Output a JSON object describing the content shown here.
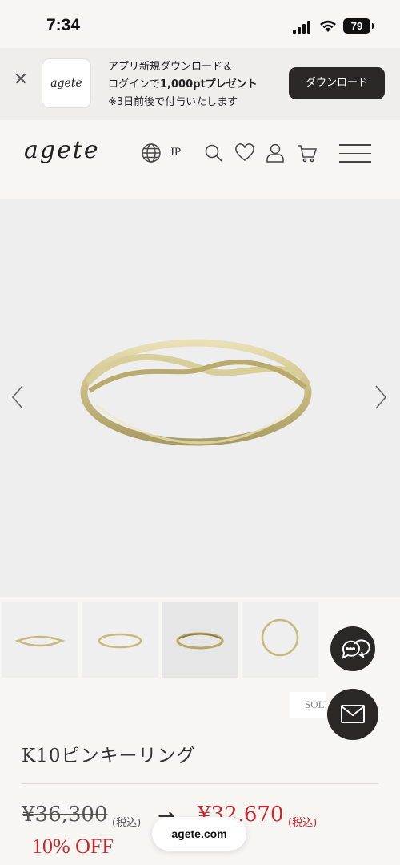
{
  "status_bar": {
    "time": "7:34",
    "battery": "79"
  },
  "app_banner": {
    "logo_text": "agete",
    "line1": "アプリ新規ダウンロード＆",
    "line2_prefix": "ログインで",
    "line2_bold": "1,000ptプレゼント",
    "line3": "※3日前後で付与いたします",
    "download_label": "ダウンロード",
    "close_icon": "close-icon"
  },
  "header": {
    "logo": "agete",
    "lang": "JP",
    "icons": [
      "globe-icon",
      "search-icon",
      "heart-icon",
      "user-icon",
      "cart-icon",
      "menu-icon"
    ]
  },
  "gallery": {
    "thumbnail_count": 4
  },
  "product": {
    "badge": "SOLD",
    "title": "K10ピンキーリング",
    "old_price": "¥36,300",
    "old_tax": "(税込)",
    "arrow": "→",
    "new_price": "¥32,670",
    "new_tax": "(税込)",
    "discount": "10% OFF"
  },
  "browser": {
    "url": "agete.com"
  },
  "colors": {
    "accent_red": "#c8282d",
    "dark_button": "#2a2725",
    "background": "#f7f6f2"
  }
}
